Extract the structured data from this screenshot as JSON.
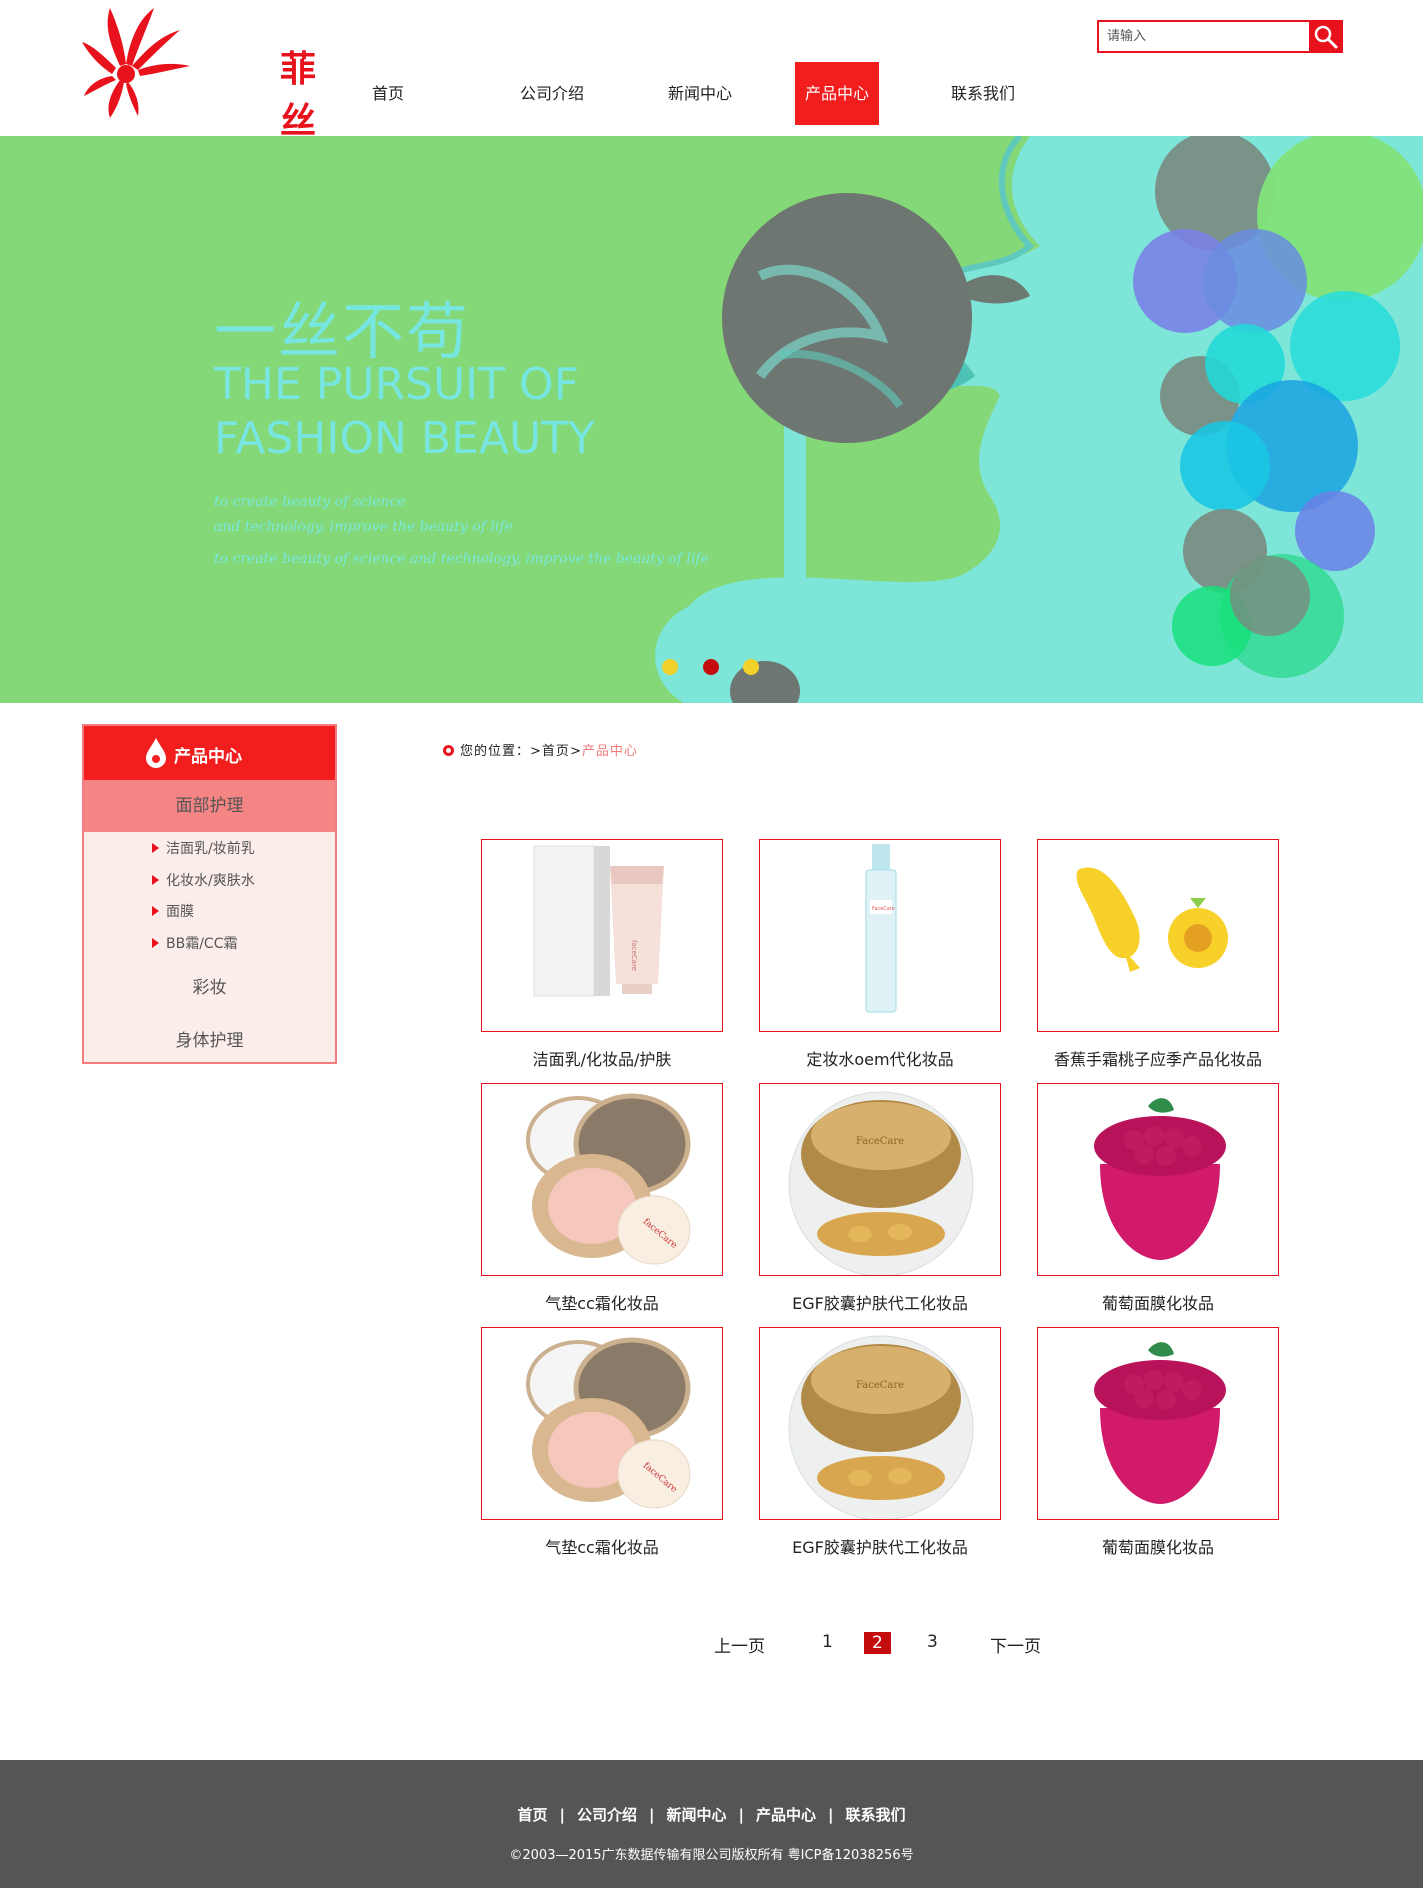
{
  "header": {
    "logo_text": "菲丝凯",
    "search": {
      "placeholder": "请输入"
    },
    "nav": [
      {
        "label": "首页"
      },
      {
        "label": "公司介绍"
      },
      {
        "label": "新闻中心"
      },
      {
        "label": "产品中心",
        "active": true
      },
      {
        "label": "联系我们"
      }
    ]
  },
  "banner": {
    "title": "一丝不苟",
    "en_line1": "THE PURSUIT OF",
    "en_line2": "FASHION BEAUTY",
    "sub1": "to create beauty of science",
    "sub2": "and technology, improve the beauty of life",
    "sub3": "to create beauty of science and technology, improve the beauty of life",
    "slide_dots": 3,
    "active_slide": 2
  },
  "sidebar": {
    "title": "产品中心",
    "categories": [
      {
        "label": "面部护理",
        "expanded": true,
        "items": [
          "洁面乳/妆前乳",
          "化妆水/爽肤水",
          "面膜",
          "BB霜/CC霜"
        ]
      },
      {
        "label": "彩妆"
      },
      {
        "label": "身体护理"
      }
    ]
  },
  "breadcrumb": {
    "prefix": "您的位置：",
    "home": "首页",
    "current": "产品中心"
  },
  "products": [
    {
      "name": "洁面乳/化妆品/护肤",
      "icon": "cleanser-tube-image"
    },
    {
      "name": "定妆水oem代化妆品",
      "icon": "spray-bottle-image"
    },
    {
      "name": "香蕉手霜桃子应季产品化妆品",
      "icon": "banana-cream-image"
    },
    {
      "name": "气垫cc霜化妆品",
      "icon": "cushion-compact-image"
    },
    {
      "name": "EGF胶囊护肤代工化妆品",
      "icon": "capsule-jar-image"
    },
    {
      "name": "葡萄面膜化妆品",
      "icon": "grape-jar-image"
    },
    {
      "name": "气垫cc霜化妆品",
      "icon": "cushion-compact-image"
    },
    {
      "name": "EGF胶囊护肤代工化妆品",
      "icon": "capsule-jar-image"
    },
    {
      "name": "葡萄面膜化妆品",
      "icon": "grape-jar-image"
    }
  ],
  "pagination": {
    "prev": "上一页",
    "pages": [
      "1",
      "2",
      "3"
    ],
    "current": "2",
    "next": "下一页"
  },
  "footer": {
    "links": [
      "首页",
      "公司介绍",
      "新闻中心",
      "产品中心",
      "联系我们"
    ],
    "copyright": "©2003—2015广东数据传输有限公司版权所有 粤ICP备12038256号"
  },
  "colors": {
    "brand_red": "#e8121c",
    "banner_green": "#84d877",
    "footer_gray": "#555555"
  }
}
